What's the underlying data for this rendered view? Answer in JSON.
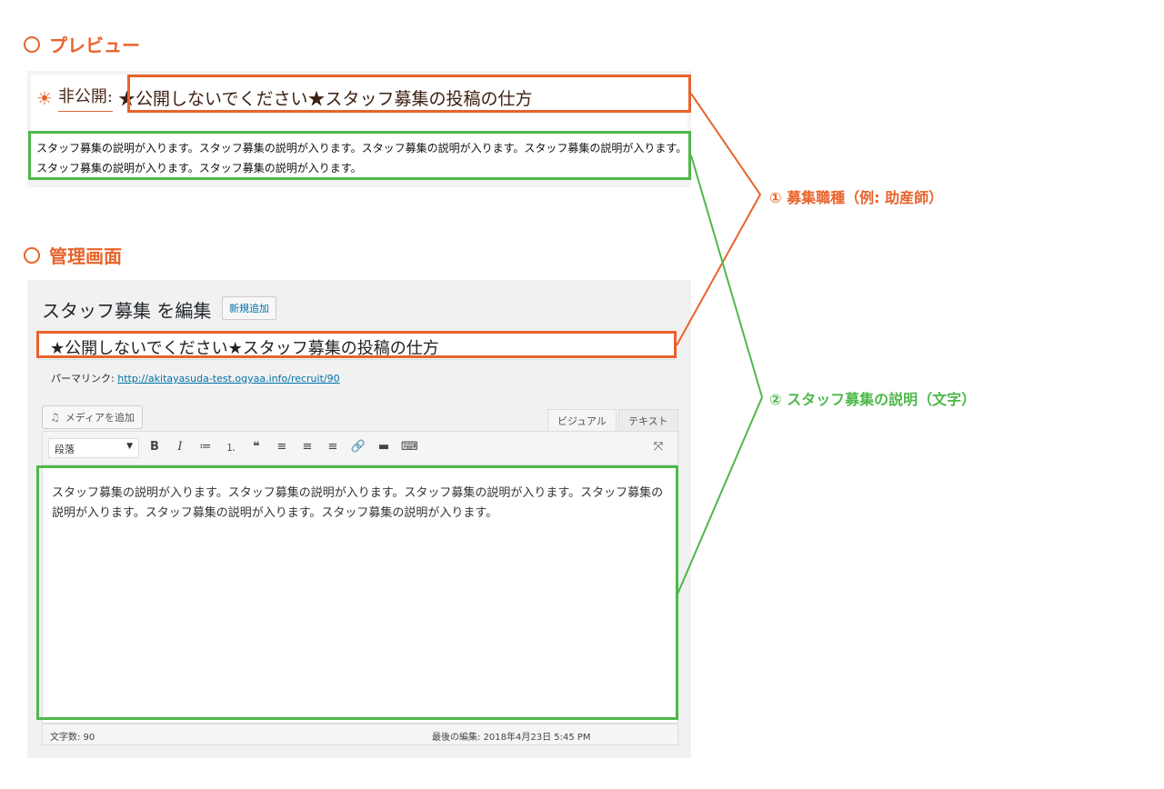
{
  "preview_section": {
    "heading": "プレビュー",
    "status_label": "非公開:",
    "post_title": "★公開しないでください★スタッフ募集の投稿の仕方",
    "description": "スタッフ募集の説明が入ります。スタッフ募集の説明が入ります。スタッフ募集の説明が入ります。スタッフ募集の説明が入ります。スタッフ募集の説明が入ります。スタッフ募集の説明が入ります。"
  },
  "admin_section": {
    "heading": "管理画面",
    "page_title": "スタッフ募集 を編集",
    "add_new_label": "新規追加",
    "post_title": "★公開しないでください★スタッフ募集の投稿の仕方",
    "permalink_label": "パーマリンク:",
    "permalink_url": "http://akitayasuda-test.ogyaa.info/recruit/90",
    "media_button_label": "メディアを追加",
    "tabs": [
      "ビジュアル",
      "テキスト"
    ],
    "format_select_value": "段落",
    "editor_content": "スタッフ募集の説明が入ります。スタッフ募集の説明が入ります。スタッフ募集の説明が入ります。スタッフ募集の説明が入ります。スタッフ募集の説明が入ります。スタッフ募集の説明が入ります。",
    "word_count": "文字数: 90",
    "last_edited": "最後の編集: 2018年4月23日 5:45 PM"
  },
  "callouts": {
    "job_type": "① 募集職種（例: 助産師）",
    "description": "② スタッフ募集の説明（文字）"
  },
  "colors": {
    "accent_orange": "#e8632b",
    "accent_green": "#4fb84a",
    "link_blue": "#0073aa"
  }
}
